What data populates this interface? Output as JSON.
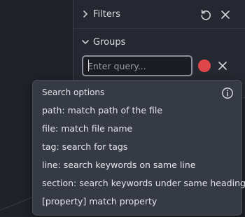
{
  "panel": {
    "filters_label": "Filters",
    "groups_label": "Groups",
    "query_placeholder": "Enter query...",
    "group_color": "#e0454a"
  },
  "search_options": {
    "title": "Search options",
    "items": [
      "path: match path of the file",
      "file: match file name",
      "tag: search for tags",
      "line: search keywords on same line",
      "section: search keywords under same heading",
      "[property] match property"
    ]
  },
  "icons": {
    "filters_chevron": "chevron-right-icon",
    "groups_chevron": "chevron-down-icon",
    "restore": "restore-icon",
    "close": "close-icon",
    "info": "info-icon"
  }
}
